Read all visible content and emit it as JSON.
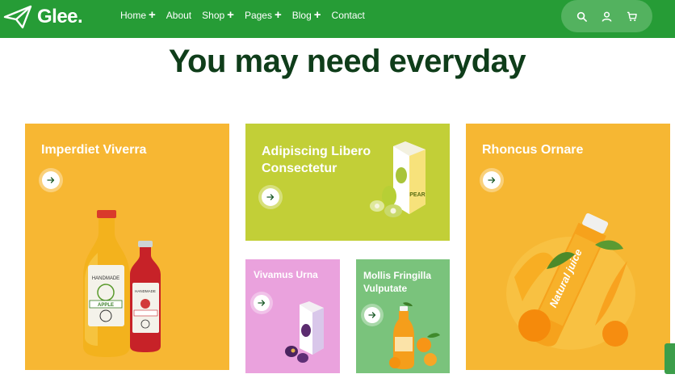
{
  "brand": {
    "name": "Glee."
  },
  "nav": {
    "items": [
      {
        "label": "Home",
        "has_submenu": true
      },
      {
        "label": "About",
        "has_submenu": false
      },
      {
        "label": "Shop",
        "has_submenu": true
      },
      {
        "label": "Pages",
        "has_submenu": true
      },
      {
        "label": "Blog",
        "has_submenu": true
      },
      {
        "label": "Contact",
        "has_submenu": false
      }
    ],
    "submenu_symbol": "+"
  },
  "header_icons": [
    "search-icon",
    "user-icon",
    "cart-icon"
  ],
  "section": {
    "title": "You may need everyday"
  },
  "cards": [
    {
      "title": "Imperdiet Viverra",
      "color": "#f7b733",
      "image": "juice-bottles"
    },
    {
      "title_lines": [
        "Adipiscing Libero",
        "Consectetur"
      ],
      "color": "#c2cf37",
      "image": "pear-juice-carton"
    },
    {
      "title": "Rhoncus Ornare",
      "color": "#f6b733",
      "image": "natural-juice-bottle"
    },
    {
      "title": "Vivamus Urna",
      "color": "#eaa2dd",
      "image": "plum-juice-carton"
    },
    {
      "title_lines": [
        "Mollis Fringilla",
        "Vulputate"
      ],
      "color": "#7ac37c",
      "image": "orange-juice-bottle"
    }
  ],
  "colors": {
    "header": "#269c36",
    "title": "#0f3d1a",
    "header_actions": "#53b25f"
  }
}
